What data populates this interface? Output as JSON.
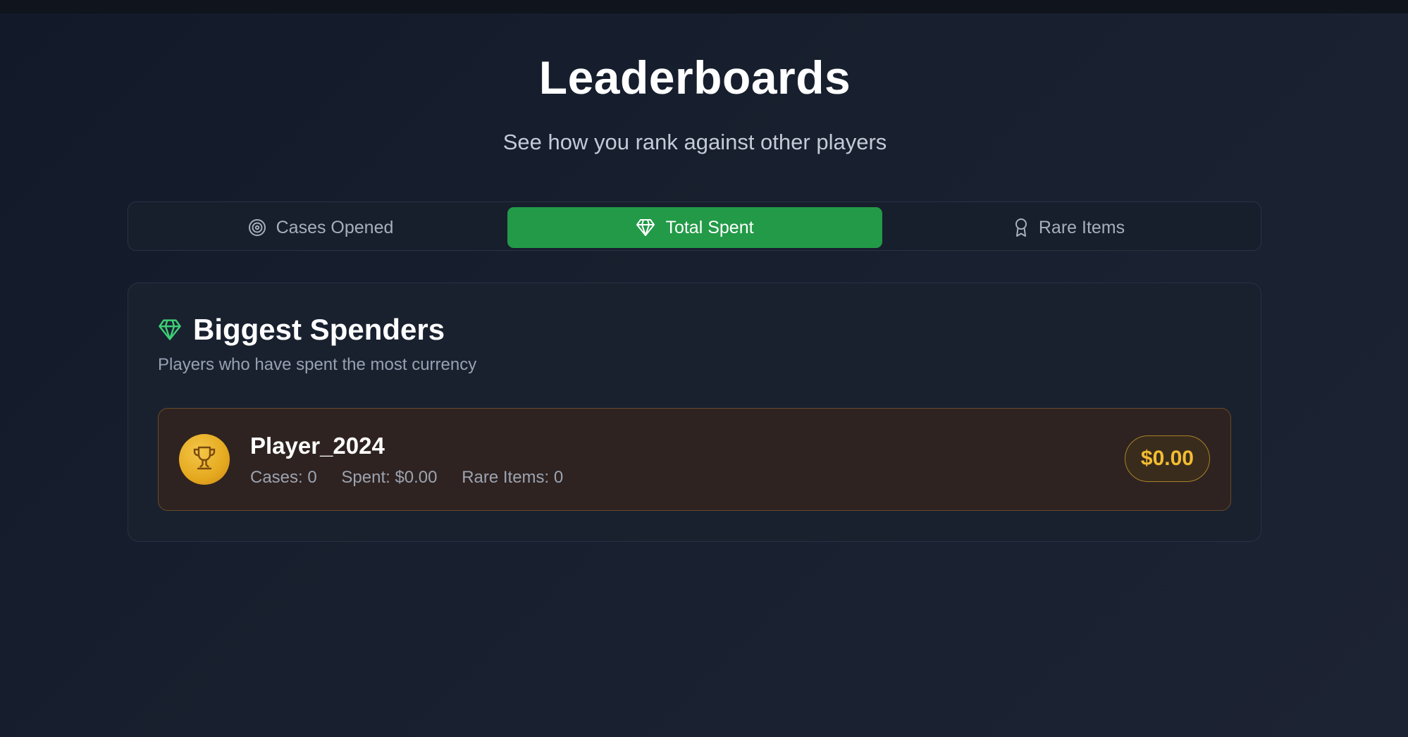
{
  "header": {
    "title": "Leaderboards",
    "subtitle": "See how you rank against other players"
  },
  "tabs": [
    {
      "label": "Cases Opened",
      "icon": "target-icon",
      "active": false
    },
    {
      "label": "Total Spent",
      "icon": "gem-icon",
      "active": true
    },
    {
      "label": "Rare Items",
      "icon": "award-icon",
      "active": false
    }
  ],
  "card": {
    "title": "Biggest Spenders",
    "description": "Players who have spent the most currency",
    "icon": "gem-icon"
  },
  "leaderboard": [
    {
      "name": "Player_2024",
      "cases": "Cases: 0",
      "spent": "Spent: $0.00",
      "rare_items": "Rare Items: 0",
      "amount": "$0.00",
      "rank_icon": "trophy-icon"
    }
  ],
  "colors": {
    "accent_green": "#229a47",
    "gem_green": "#3ecf76",
    "gold": "#f2bd32"
  }
}
